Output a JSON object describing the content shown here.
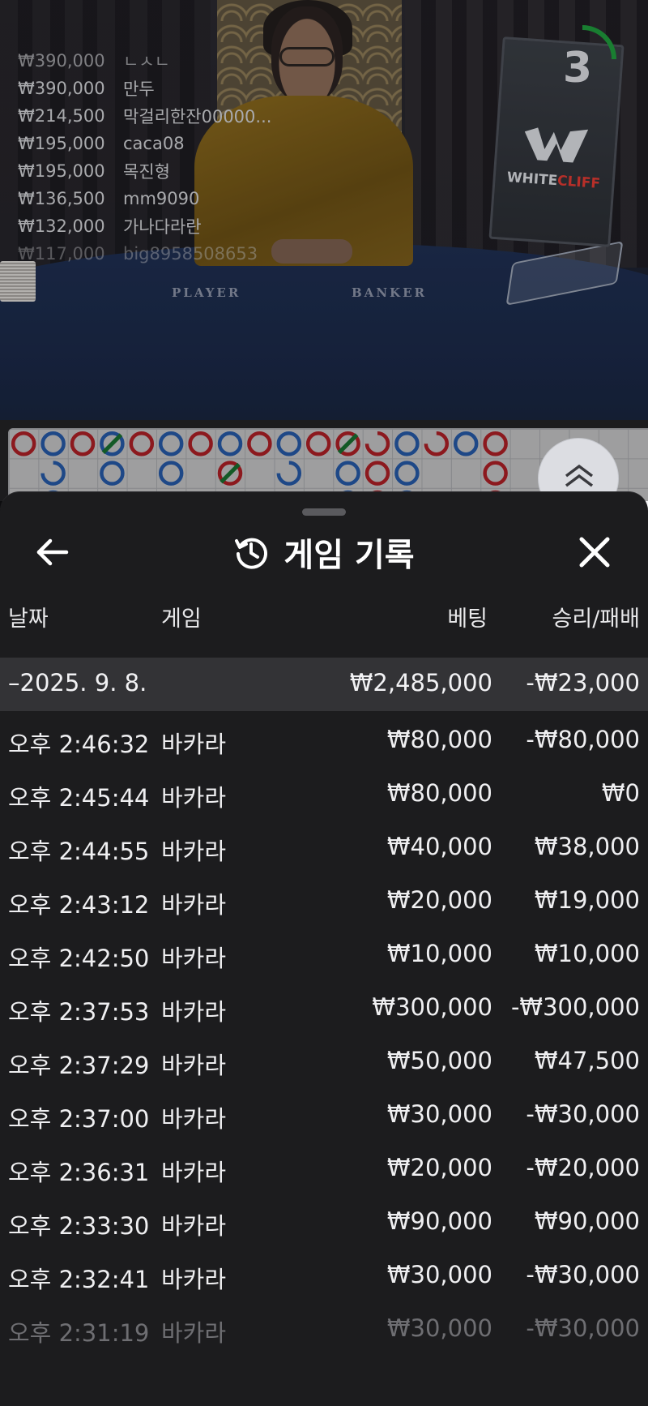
{
  "stream": {
    "timer": "3",
    "brand_left": "WHITE",
    "brand_right": "CLIFF",
    "felt_player": "PLAYER",
    "felt_banker": "BANKER",
    "winners": [
      {
        "amount": "₩390,000",
        "name": "ㄴㅅㄴ"
      },
      {
        "amount": "₩390,000",
        "name": "만두"
      },
      {
        "amount": "₩214,500",
        "name": "막걸리한잔00000..."
      },
      {
        "amount": "₩195,000",
        "name": "caca08"
      },
      {
        "amount": "₩195,000",
        "name": "목진형"
      },
      {
        "amount": "₩136,500",
        "name": "mm9090"
      },
      {
        "amount": "₩132,000",
        "name": "가나다라란"
      },
      {
        "amount": "₩117,000",
        "name": "big8958508653"
      }
    ]
  },
  "colors": {
    "banker": "#d8272f",
    "player": "#2f6fd0",
    "tie": "#1e8a3b",
    "sheet_bg": "#1c1c1e",
    "day_row_bg": "#333336"
  },
  "roadmap": {
    "columns": [
      [
        "banker",
        null,
        null
      ],
      [
        "player",
        "player-half",
        "player"
      ],
      [
        "banker",
        null,
        null
      ],
      [
        "player-tie",
        "player",
        null
      ],
      [
        "banker",
        null,
        null
      ],
      [
        "player",
        "player",
        null
      ],
      [
        "banker",
        null,
        null
      ],
      [
        "player",
        "banker-tie",
        null
      ],
      [
        "banker",
        null,
        null
      ],
      [
        "player",
        "player-half",
        null
      ],
      [
        "banker",
        null,
        null
      ],
      [
        "banker-tie",
        "player",
        "player"
      ],
      [
        "banker-half",
        "banker",
        "banker"
      ],
      [
        "player",
        "player",
        "player"
      ],
      [
        "banker-half",
        null,
        null
      ],
      [
        "player",
        null,
        null
      ],
      [
        "banker",
        "banker",
        "banker"
      ]
    ]
  },
  "sheet": {
    "title": "게임 기록",
    "icons": {
      "back": "arrow-left-icon",
      "history": "history-icon",
      "close": "close-icon"
    },
    "headers": {
      "date": "날짜",
      "game": "게임",
      "bet": "베팅",
      "winloss": "승리/패배"
    },
    "day": {
      "date": "–2025. 9. 8.",
      "bet": "₩2,485,000",
      "winloss": "-₩23,000"
    },
    "rows": [
      {
        "time": "오후 2:46:32",
        "game": "바카라",
        "bet": "₩80,000",
        "winloss": "-₩80,000"
      },
      {
        "time": "오후 2:45:44",
        "game": "바카라",
        "bet": "₩80,000",
        "winloss": "₩0"
      },
      {
        "time": "오후 2:44:55",
        "game": "바카라",
        "bet": "₩40,000",
        "winloss": "₩38,000"
      },
      {
        "time": "오후 2:43:12",
        "game": "바카라",
        "bet": "₩20,000",
        "winloss": "₩19,000"
      },
      {
        "time": "오후 2:42:50",
        "game": "바카라",
        "bet": "₩10,000",
        "winloss": "₩10,000"
      },
      {
        "time": "오후 2:37:53",
        "game": "바카라",
        "bet": "₩300,000",
        "winloss": "-₩300,000"
      },
      {
        "time": "오후 2:37:29",
        "game": "바카라",
        "bet": "₩50,000",
        "winloss": "₩47,500"
      },
      {
        "time": "오후 2:37:00",
        "game": "바카라",
        "bet": "₩30,000",
        "winloss": "-₩30,000"
      },
      {
        "time": "오후 2:36:31",
        "game": "바카라",
        "bet": "₩20,000",
        "winloss": "-₩20,000"
      },
      {
        "time": "오후 2:33:30",
        "game": "바카라",
        "bet": "₩90,000",
        "winloss": "₩90,000"
      },
      {
        "time": "오후 2:32:41",
        "game": "바카라",
        "bet": "₩30,000",
        "winloss": "-₩30,000"
      },
      {
        "time": "오후 2:31:19",
        "game": "바카라",
        "bet": "₩30,000",
        "winloss": "-₩30,000"
      }
    ]
  }
}
